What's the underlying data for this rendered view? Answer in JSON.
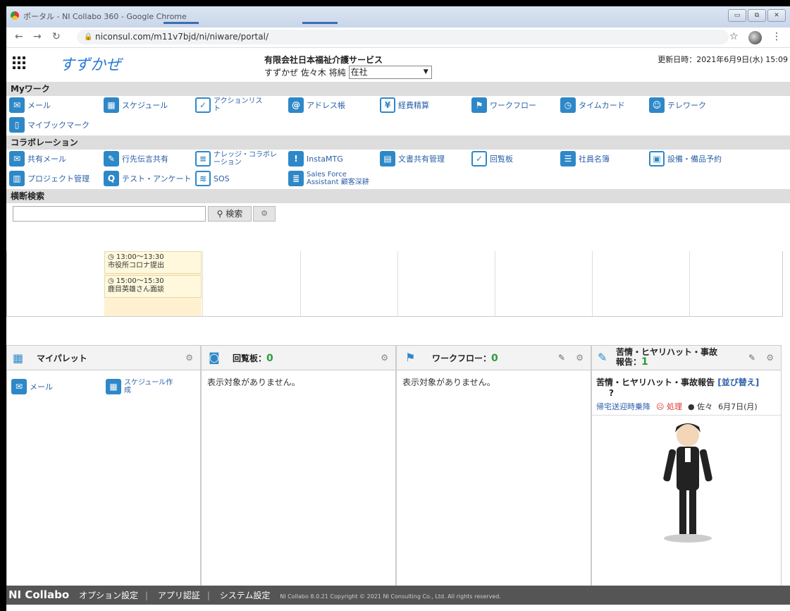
{
  "browser": {
    "title": "ポータル - NI Collabo 360 - Google Chrome",
    "url": "niconsul.com/m11v7bjd/ni/niware/portal/"
  },
  "header": {
    "logo": "すずかぜ",
    "company": "有限会社日本福祉介護サービス",
    "user": "すずかぜ  佐々木 将純",
    "status": "在社",
    "updated": "更新日時：2021年6月9日(水) 15:09"
  },
  "mywork": {
    "title": "Myワーク",
    "items": [
      {
        "label": "メール",
        "icon": "mail-icon"
      },
      {
        "label": "スケジュール",
        "icon": "schedule-icon"
      },
      {
        "label": "アクションリスト",
        "icon": "checklist-icon"
      },
      {
        "label": "アドレス帳",
        "icon": "address-icon"
      },
      {
        "label": "経費精算",
        "icon": "expense-icon"
      },
      {
        "label": "ワークフロー",
        "icon": "workflow-icon"
      },
      {
        "label": "タイムカード",
        "icon": "timecard-icon"
      },
      {
        "label": "テレワーク",
        "icon": "telework-icon"
      },
      {
        "label": "マイブックマーク",
        "icon": "bookmark-icon"
      }
    ]
  },
  "collab": {
    "title": "コラボレーション",
    "items": [
      {
        "label": "共有メール",
        "icon": "shared-mail-icon"
      },
      {
        "label": "行先伝言共有",
        "icon": "message-icon"
      },
      {
        "label": "ナレッジ・コラボレーション",
        "icon": "knowledge-icon"
      },
      {
        "label": "InstaMTG",
        "icon": "instamtg-icon"
      },
      {
        "label": "文書共有管理",
        "icon": "document-icon"
      },
      {
        "label": "回覧板",
        "icon": "circular-icon"
      },
      {
        "label": "社員名簿",
        "icon": "staff-icon"
      },
      {
        "label": "設備・備品予約",
        "icon": "facility-icon"
      },
      {
        "label": "プロジェクト管理",
        "icon": "project-icon"
      },
      {
        "label": "テスト・アンケート",
        "icon": "survey-icon"
      },
      {
        "label": "SOS",
        "icon": "sos-icon"
      },
      {
        "label": "Sales Force Assistant 顧客深耕",
        "icon": "sfa-icon"
      }
    ]
  },
  "search": {
    "title": "横断検索",
    "button": "検索"
  },
  "calendar": {
    "events": [
      {
        "time": "13:00〜13:30",
        "title": "市役所コロナ提出"
      },
      {
        "time": "15:00〜15:30",
        "title": "鹿目英雄さん面談"
      }
    ]
  },
  "panels": {
    "mypalette": {
      "title": "マイパレット",
      "items": [
        "メール",
        "スケジュール作成"
      ]
    },
    "circular": {
      "title": "回覧板：",
      "count": "0",
      "empty": "表示対象がありません。"
    },
    "workflow": {
      "title": "ワークフロー：",
      "count": "0",
      "empty": "表示対象がありません。"
    },
    "complaint": {
      "title": "苦情・ヒヤリハット・事故報告：",
      "count": "1",
      "subtitle": "苦情・ヒヤリハット・事故報告",
      "sort": "[並び替え]",
      "q": "?",
      "row": {
        "title": "帰宅送迎時乗降",
        "status": "処理",
        "user": "佐々",
        "date": "6月7日(月)"
      }
    }
  },
  "footer": {
    "brand": "NI Collabo",
    "links": [
      "オプション設定",
      "アプリ認証",
      "システム設定"
    ],
    "copyright": "NI Collabo 8.0.21 Copyright © 2021 NI Consulting Co., Ltd. All rights reserved."
  }
}
